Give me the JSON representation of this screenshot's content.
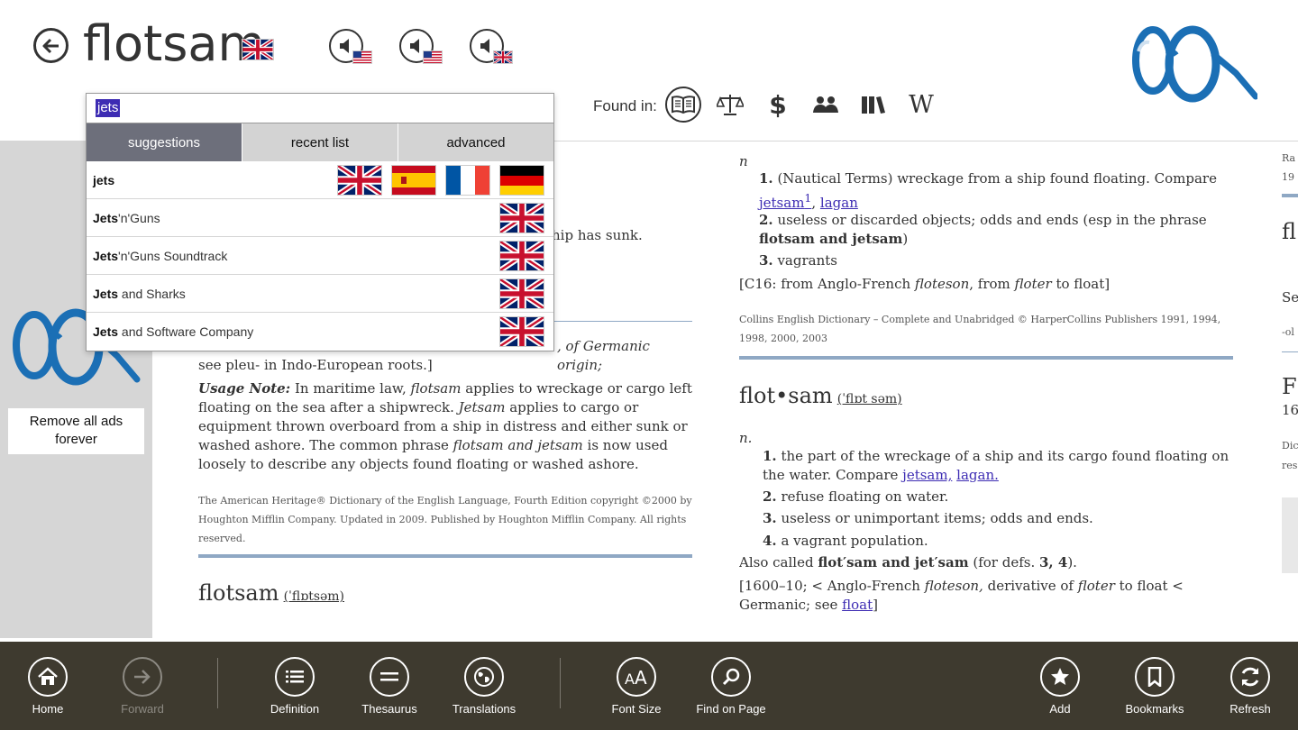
{
  "header": {
    "title": "flotsam",
    "found_in": "Found in:"
  },
  "search": {
    "query": "jets",
    "tabs": [
      "suggestions",
      "recent list",
      "advanced"
    ],
    "suggestions": [
      {
        "bold": "jets",
        "rest": "",
        "flags": [
          "uk",
          "es",
          "fr",
          "de"
        ]
      },
      {
        "bold": "Jets",
        "rest": "'n'Guns",
        "flags": [
          "uk"
        ]
      },
      {
        "bold": "Jets",
        "rest": "'n'Guns Soundtrack",
        "flags": [
          "uk"
        ]
      },
      {
        "bold": "Jets",
        "rest": " and Sharks",
        "flags": [
          "uk"
        ]
      },
      {
        "bold": "Jets",
        "rest": " and Software Company",
        "flags": [
          "uk"
        ]
      }
    ]
  },
  "ad": {
    "remove_line1": "Remove all ads",
    "remove_line2": "forever"
  },
  "col1": {
    "partial_line": "hip has sunk.",
    "origin_partial": ", of Germanic origin;",
    "origin_line2": "see pleu- in Indo-European roots.]",
    "usage_label": "Usage Note:",
    "usage_p1": " In maritime law, ",
    "usage_i1": "flotsam",
    "usage_p2": " applies to wreckage or cargo left floating on the sea after a shipwreck. ",
    "usage_i2": "Jetsam",
    "usage_p3": " applies to cargo or equipment thrown overboard from a ship in distress and either sunk or washed ashore. The common phrase ",
    "usage_i3": "flotsam and jetsam",
    "usage_p4": " is now used loosely to describe any objects found floating or washed ashore.",
    "source": "The American Heritage® Dictionary of the English Language, Fourth Edition copyright ©2000 by Houghton Mifflin Company. Updated in 2009. Published by Houghton Mifflin Company. All rights reserved.",
    "headword": "flotsam",
    "pron": "(ˈflɒtsəm)"
  },
  "col2": {
    "pos": "n",
    "d1_num": "1.",
    "d1_text": "(Nautical Terms) wreckage from a ship found floating. Compare ",
    "d1_link1": "jetsam",
    "d1_sup": "1",
    "d1_sep": ", ",
    "d1_link2": "lagan",
    "d2_num": "2.",
    "d2_text": "useless or discarded objects; odds and ends (esp in the phrase ",
    "d2_bold": "flotsam and jetsam",
    "d2_end": ")",
    "d3_num": "3.",
    "d3_text": "vagrants",
    "etym_p1": "[C16: from Anglo-French ",
    "etym_i1": "floteson",
    "etym_p2": ", from ",
    "etym_i2": "floter",
    "etym_p3": " to float]",
    "source": "Collins English Dictionary – Complete and Unabridged © HarperCollins Publishers 1991, 1994, 1998, 2000, 2003",
    "headword": "flot•sam",
    "pron": "(ˈflɒt səm)",
    "pos2": "n.",
    "e1_num": "1.",
    "e1_text": "the part of the wreckage of a ship and its cargo found floating on the water. Compare ",
    "e1_link1": "jetsam,",
    "e1_link2": "lagan.",
    "e2_num": "2.",
    "e2_text": "refuse floating on water.",
    "e3_num": "3.",
    "e3_text": "useless or unimportant items; odds and ends.",
    "e4_num": "4.",
    "e4_text": "a vagrant population.",
    "also_p1": "Also called ",
    "also_b1": "flot′sam and jet′sam",
    "also_p2": " (for defs. ",
    "also_b2": "3, 4",
    "also_p3": ").",
    "etym2_p1": "[1600–10; < Anglo-French ",
    "etym2_i1": "floteson,",
    "etym2_p2": " derivative of ",
    "etym2_i2": "floter",
    "etym2_p3": " to float < Germanic; see ",
    "etym2_link": "float",
    "etym2_end": "]"
  },
  "col3": {
    "l1": "Ra",
    "l2": "19",
    "l3": "fl",
    "l4": "Se",
    "l5": "-ol",
    "l6": "F",
    "l7": "16",
    "l8": "Dic",
    "l9": "res"
  },
  "appbar": {
    "home": "Home",
    "forward": "Forward",
    "definition": "Definition",
    "thesaurus": "Thesaurus",
    "translations": "Translations",
    "font_size": "Font Size",
    "find_on_page": "Find on Page",
    "add": "Add",
    "bookmarks": "Bookmarks",
    "refresh": "Refresh"
  },
  "colors": {
    "appbar_bg": "#3e3a2f",
    "link": "#3d2cb3",
    "logo_blue": "#1b6fb5",
    "rule": "#8fa8c4"
  }
}
